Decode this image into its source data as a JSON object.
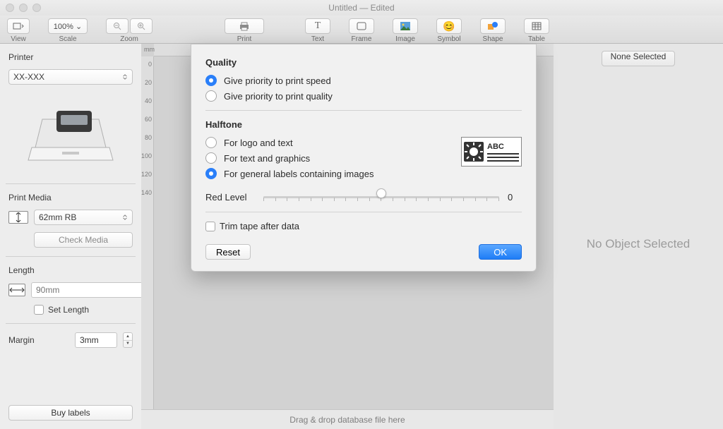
{
  "title": {
    "name": "Untitled",
    "state": "Edited"
  },
  "toolbar": {
    "view": "View",
    "scale_value": "100% ⌄",
    "scale": "Scale",
    "zoom": "Zoom",
    "print": "Print",
    "text": "Text",
    "frame": "Frame",
    "image": "Image",
    "symbol": "Symbol",
    "shape": "Shape",
    "table": "Table"
  },
  "sidebar": {
    "printer_label": "Printer",
    "printer_value": "XX-XXX",
    "print_media_label": "Print Media",
    "media_value": "62mm RB",
    "check_media": "Check Media",
    "length_label": "Length",
    "length_placeholder": "90mm",
    "set_length": "Set Length",
    "margin_label": "Margin",
    "margin_value": "3mm",
    "buy_labels": "Buy labels"
  },
  "ruler": {
    "unit": "mm",
    "v_ticks": [
      "0",
      "20",
      "40",
      "60",
      "80",
      "100",
      "120",
      "140"
    ]
  },
  "canvas": {
    "footer": "Drag & drop database file here"
  },
  "rightpanel": {
    "none_selected": "None Selected",
    "message": "No Object Selected"
  },
  "sheet": {
    "quality_title": "Quality",
    "q_speed": "Give priority to print speed",
    "q_quality": "Give priority to print quality",
    "halftone_title": "Halftone",
    "h_logo": "For logo and text",
    "h_text": "For text and graphics",
    "h_images": "For general labels containing images",
    "halftone_sample": "ABC",
    "red_level_label": "Red Level",
    "red_level_value": "0",
    "trim_tape": "Trim tape after data",
    "reset": "Reset",
    "ok": "OK"
  }
}
